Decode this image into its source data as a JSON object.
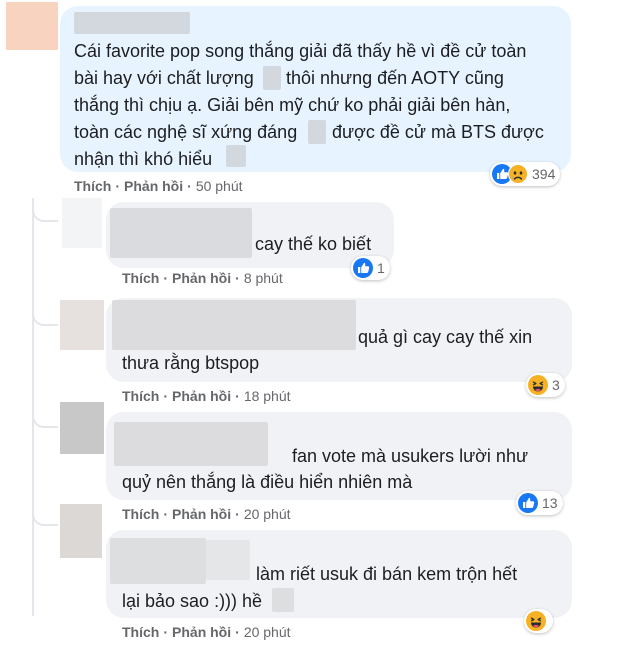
{
  "comments": [
    {
      "lines": [
        "Cái favorite pop song thắng giải đã thấy hề vì đề cử toàn",
        "bài hay với chất lượng",
        "thôi nhưng đến AOTY cũng",
        "thắng thì chịu ạ. Giải bên mỹ chứ ko phải giải bên hàn,",
        "toàn các nghệ sĩ xứng đáng",
        "được đề cử mà BTS được",
        "nhận thì khó hiểu"
      ],
      "like_label": "Thích",
      "reply_label": "Phản hồi",
      "time": "50 phút",
      "reactions": [
        "like-icon",
        "sad-icon"
      ],
      "reaction_count": "394"
    },
    {
      "lines": [
        "cay thế ko biết"
      ],
      "like_label": "Thích",
      "reply_label": "Phản hồi",
      "time": "8 phút",
      "reactions": [
        "like-icon"
      ],
      "reaction_count": "1"
    },
    {
      "lines": [
        "quả gì cay cay thế xin",
        "thưa rằng btspop"
      ],
      "like_label": "Thích",
      "reply_label": "Phản hồi",
      "time": "18 phút",
      "reactions": [
        "haha-icon"
      ],
      "reaction_count": "3"
    },
    {
      "lines": [
        "fan vote mà usukers lười như",
        "quỷ nên thắng là điều hiển nhiên mà"
      ],
      "like_label": "Thích",
      "reply_label": "Phản hồi",
      "time": "20 phút",
      "reactions": [
        "like-icon"
      ],
      "reaction_count": "13"
    },
    {
      "lines": [
        "làm riết usuk đi bán kem trộn hết",
        "lại bảo sao :))) hề"
      ],
      "like_label": "Thích",
      "reply_label": "Phản hồi",
      "time": "20 phút",
      "reactions": [
        "haha-icon"
      ],
      "reaction_count": ""
    }
  ],
  "colors": {
    "main_bubble": "#e7f3ff",
    "reply_bubble": "#f0f2f5",
    "like_blue": "#1877f2",
    "haha_yellow": "#f7b125"
  }
}
